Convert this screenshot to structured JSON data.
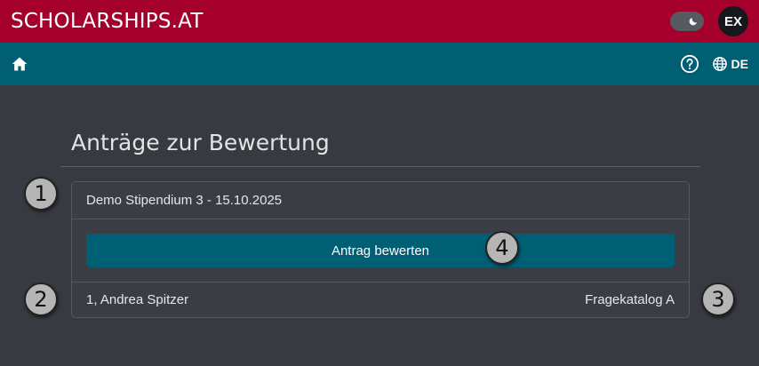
{
  "header": {
    "brand": "SCHOLARSHIPS.AT",
    "avatar_initials": "EX",
    "brand_color": "#a5002b"
  },
  "nav": {
    "home_icon": "home-icon",
    "help_icon": "help-circle-icon",
    "language_icon": "globe-icon",
    "language_label": "DE",
    "nav_color": "#005f73"
  },
  "main": {
    "title": "Anträge zur Bewertung",
    "card": {
      "header": "Demo Stipendium 3 - 15.10.2025",
      "button_label": "Antrag bewerten",
      "applicant": "1, Andrea Spitzer",
      "catalog": "Fragekatalog A"
    }
  },
  "markers": [
    "1",
    "2",
    "3",
    "4"
  ]
}
